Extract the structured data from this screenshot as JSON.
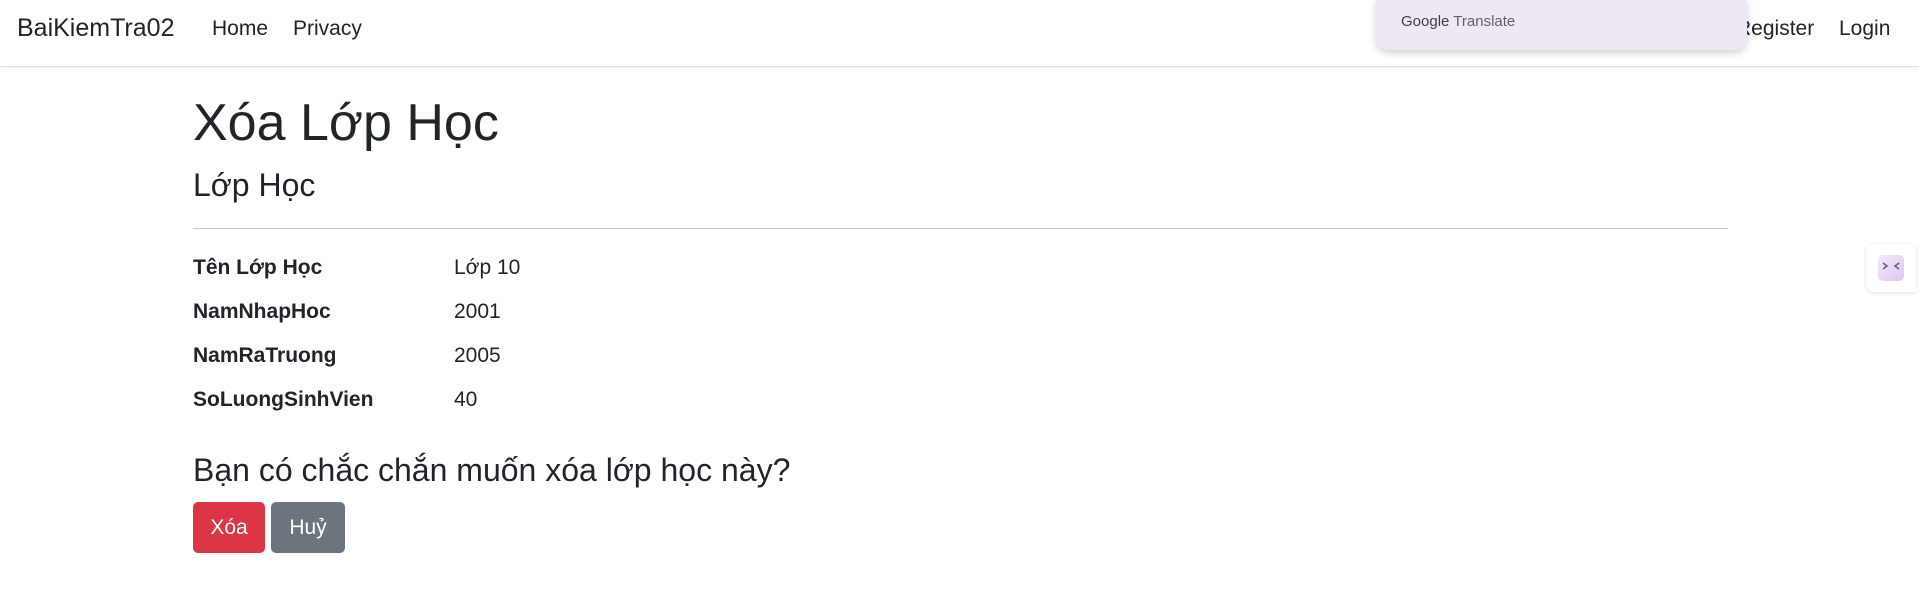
{
  "navbar": {
    "brand": "BaiKiemTra02",
    "links": [
      "Home",
      "Privacy"
    ],
    "auth": {
      "register": "Register",
      "login": "Login"
    }
  },
  "google_translate": {
    "brand": "Google",
    "label": "Translate"
  },
  "side_widget": {
    "icon": "collapse-arrows-icon"
  },
  "page": {
    "title": "Xóa Lớp Học",
    "subtitle": "Lớp Học",
    "details": [
      {
        "label": "Tên Lớp Học",
        "value": "Lớp 10"
      },
      {
        "label": "NamNhapHoc",
        "value": "2001"
      },
      {
        "label": "NamRaTruong",
        "value": "2005"
      },
      {
        "label": "SoLuongSinhVien",
        "value": "40"
      }
    ],
    "confirm_question": "Bạn có chắc chắn muốn xóa lớp học này?",
    "buttons": {
      "delete": "Xóa",
      "cancel": "Huỷ"
    }
  },
  "colors": {
    "danger": "#dc3545",
    "secondary": "#6c757d",
    "translate_bg": "#efe8f4"
  }
}
